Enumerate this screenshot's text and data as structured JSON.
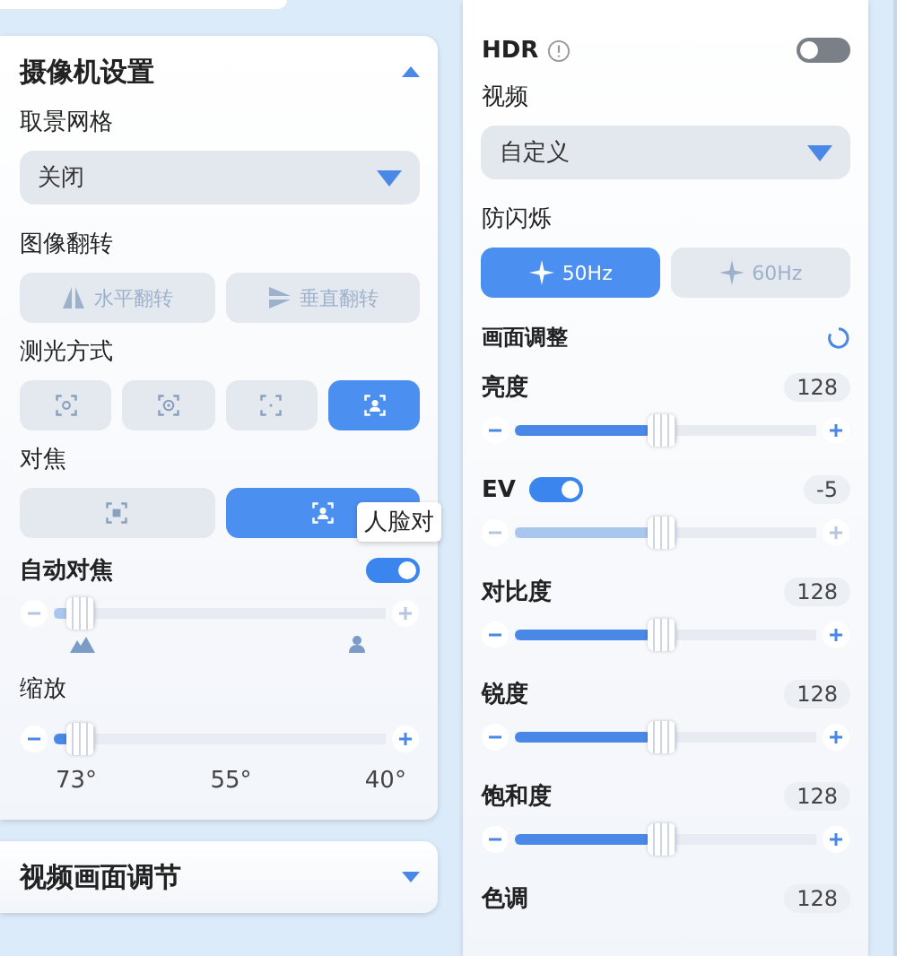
{
  "camera_panel": {
    "title": "摄像机设置",
    "expanded": true,
    "grid": {
      "label": "取景网格",
      "value": "关闭"
    },
    "flip": {
      "label": "图像翻转",
      "buttons": [
        {
          "label": "水平翻转",
          "disabled": true
        },
        {
          "label": "垂直翻转",
          "disabled": true
        }
      ]
    },
    "metering": {
      "label": "测光方式",
      "options": [
        {
          "selected": false
        },
        {
          "selected": false
        },
        {
          "selected": false
        },
        {
          "selected": true
        }
      ]
    },
    "focus": {
      "label": "对焦",
      "options": [
        {
          "selected": false
        },
        {
          "selected": true
        }
      ],
      "tooltip": "人脸对"
    },
    "autofocus": {
      "label": "自动对焦",
      "on": true,
      "level": 0.05,
      "muted": true
    },
    "zoom": {
      "label": "缩放",
      "level": 0.05,
      "muted": false,
      "ticks": [
        "73°",
        "55°",
        "40°"
      ]
    }
  },
  "collapsed_panel": {
    "title": "视频画面调节",
    "expanded": false
  },
  "video_panel": {
    "hdr": {
      "label": "HDR",
      "on": false
    },
    "video": {
      "label": "视频",
      "value": "自定义"
    },
    "anti_flicker": {
      "label": "防闪烁",
      "options": [
        {
          "label": "50Hz",
          "selected": true
        },
        {
          "label": "60Hz",
          "selected": false
        }
      ]
    },
    "adjust_title": "画面调整",
    "sliders": [
      {
        "kind": "plain",
        "label": "亮度",
        "value": "128",
        "level": 0.45,
        "muted": false
      },
      {
        "kind": "toggle",
        "label": "EV",
        "on": true,
        "value": "-5",
        "level": 0.45,
        "muted": true
      },
      {
        "kind": "plain",
        "label": "对比度",
        "value": "128",
        "level": 0.45,
        "muted": false
      },
      {
        "kind": "plain",
        "label": "锐度",
        "value": "128",
        "level": 0.45,
        "muted": false
      },
      {
        "kind": "plain",
        "label": "饱和度",
        "value": "128",
        "level": 0.45,
        "muted": false
      },
      {
        "kind": "plain",
        "label": "色调",
        "value": "128"
      }
    ]
  }
}
